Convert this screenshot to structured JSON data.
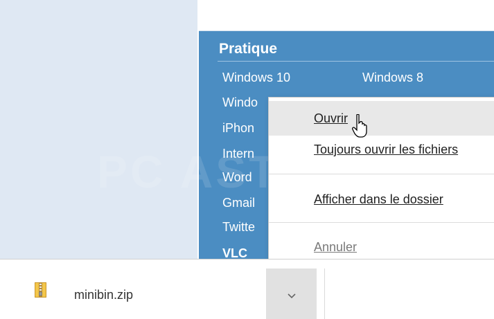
{
  "panel": {
    "title": "Pratique",
    "links": [
      "Windows 10",
      "Windows 8",
      "Windo",
      "iPhon",
      "Intern",
      "Word",
      "Gmail",
      "Twitte",
      "VLC"
    ]
  },
  "watermark": "PC ASTUCES",
  "context_menu": {
    "items": [
      {
        "label": "Ouvrir",
        "state": "highlighted",
        "accelerator": "O"
      },
      {
        "label": "Toujours ouvrir les fichiers",
        "accelerator": "T"
      },
      {
        "label": "Afficher dans le dossier",
        "accelerator": "A"
      },
      {
        "label": "Annuler",
        "state": "disabled",
        "accelerator": "A"
      }
    ]
  },
  "download_bar": {
    "file_name": "minibin.zip",
    "file_icon": "zip-archive-icon",
    "menu_button_icon": "chevron-down-icon"
  },
  "colors": {
    "panel_blue": "#4b8dc2",
    "left_pane": "#dfe8f3",
    "menu_highlight": "#e8e8e8"
  }
}
